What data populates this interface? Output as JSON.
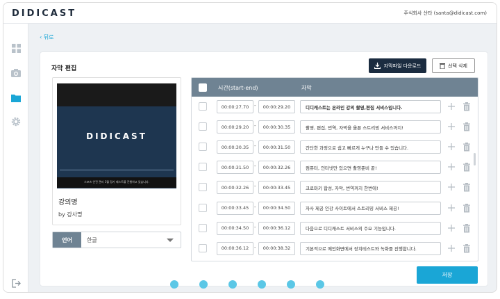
{
  "brand": {
    "logo_text": "DIDICAST"
  },
  "account": {
    "label": "주식회사 산타 (santa@didicast.com)"
  },
  "sidebar": {
    "items": [
      {
        "icon": "grid-icon"
      },
      {
        "icon": "camera-icon"
      },
      {
        "icon": "folder-icon",
        "active": true
      },
      {
        "icon": "gear-icon"
      },
      {
        "icon": "logout-icon"
      }
    ]
  },
  "nav": {
    "back_label": "뒤로"
  },
  "page": {
    "title": "자막 편집"
  },
  "toolbar": {
    "download_label": "자막파일 다운로드",
    "delete_label": "선택 삭제"
  },
  "video": {
    "logo_text": "DIDICAST",
    "subtitle_text": "스포츠 안전 관리 3월 정기 테스트를 진행하고 있습니다."
  },
  "lecture": {
    "title": "강의명",
    "lecturer": "by 강사명"
  },
  "language": {
    "label": "언어",
    "selected": "한글"
  },
  "table": {
    "columns": {
      "time": "시간(start-end)",
      "subtitle": "자막"
    },
    "rows": [
      {
        "start": "00:00:27.70",
        "end": "00:00:29.20",
        "text": "디디캐스트는 온라인 강의 촬영,편집 서비스입니다.",
        "bold": true
      },
      {
        "start": "00:00:29.20",
        "end": "00:00:30.35",
        "text": "촬영, 편집, 번역, 자막을 올픈 스트리밍 서비스까지!"
      },
      {
        "start": "00:00:30.35",
        "end": "00:00:31.50",
        "text": "간단한 과정으로 쉽고 빠르게 누구나 만들 수 있습니다."
      },
      {
        "start": "00:00:31.50",
        "end": "00:00:32.26",
        "text": "컴퓨터, 인터넷만 있으면 촬영준비 끝!"
      },
      {
        "start": "00:00:32.26",
        "end": "00:00:33.45",
        "text": "크로마키 합성, 자막, 번역까지 한번에!"
      },
      {
        "start": "00:00:33.45",
        "end": "00:00:34.50",
        "text": "자사 제공 인강 사이트에서 스트리밍 서비스 제공!"
      },
      {
        "start": "00:00:34.50",
        "end": "00:00:36.12",
        "text": "다음으로 디디캐스트 서비스의 주요 기능입니다."
      },
      {
        "start": "00:00:36.12",
        "end": "00:00:38.32",
        "text": "기본적으로 에인화면에서 장치테스트와 녹화를 진행합니다."
      }
    ]
  },
  "actions": {
    "save_label": "저장"
  },
  "colors": {
    "accent": "#1aa6d6",
    "navy": "#1b2c40",
    "table_header": "#6f8393"
  },
  "pagination_dots": 6
}
